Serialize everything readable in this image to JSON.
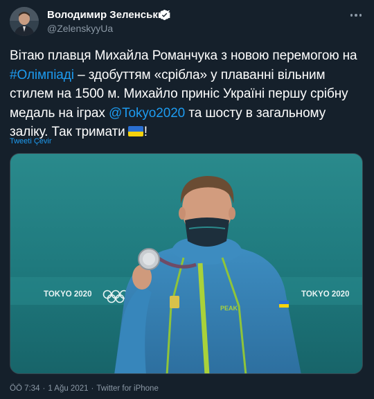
{
  "author": {
    "display_name": "Володимир Зеленський",
    "handle": "@ZelenskyyUa",
    "verified": true
  },
  "tweet": {
    "text_parts": {
      "p1": "Вітаю плавця Михайла Романчука з новою перемогою на ",
      "hashtag": "#Олімпіаді",
      "p2": " – здобуттям «срібла» у плаванні вільним стилем на 1500 м. Михайло приніс Україні першу срібну медаль на іграх ",
      "mention": "@Tokyo2020",
      "p3": " та шосту в загальному заліку. Так тримати",
      "p4": "!"
    },
    "translate_label": "Tweeti Çevir",
    "media": {
      "banner_left": "TOKYO 2020",
      "banner_right": "TOKYO 2020",
      "jacket_brand": "PEAK"
    }
  },
  "meta": {
    "time": "ÖÖ 7:34",
    "date": "1 Ağu 2021",
    "source": "Twitter for iPhone",
    "separator": "·"
  },
  "colors": {
    "background": "#15202b",
    "link": "#1d9bf0",
    "secondary_text": "#8b98a5",
    "verified": "#ffffff"
  },
  "icons": {
    "verified": "verified-badge-icon",
    "more": "more-options-icon",
    "flag": "ukraine-flag-icon"
  }
}
